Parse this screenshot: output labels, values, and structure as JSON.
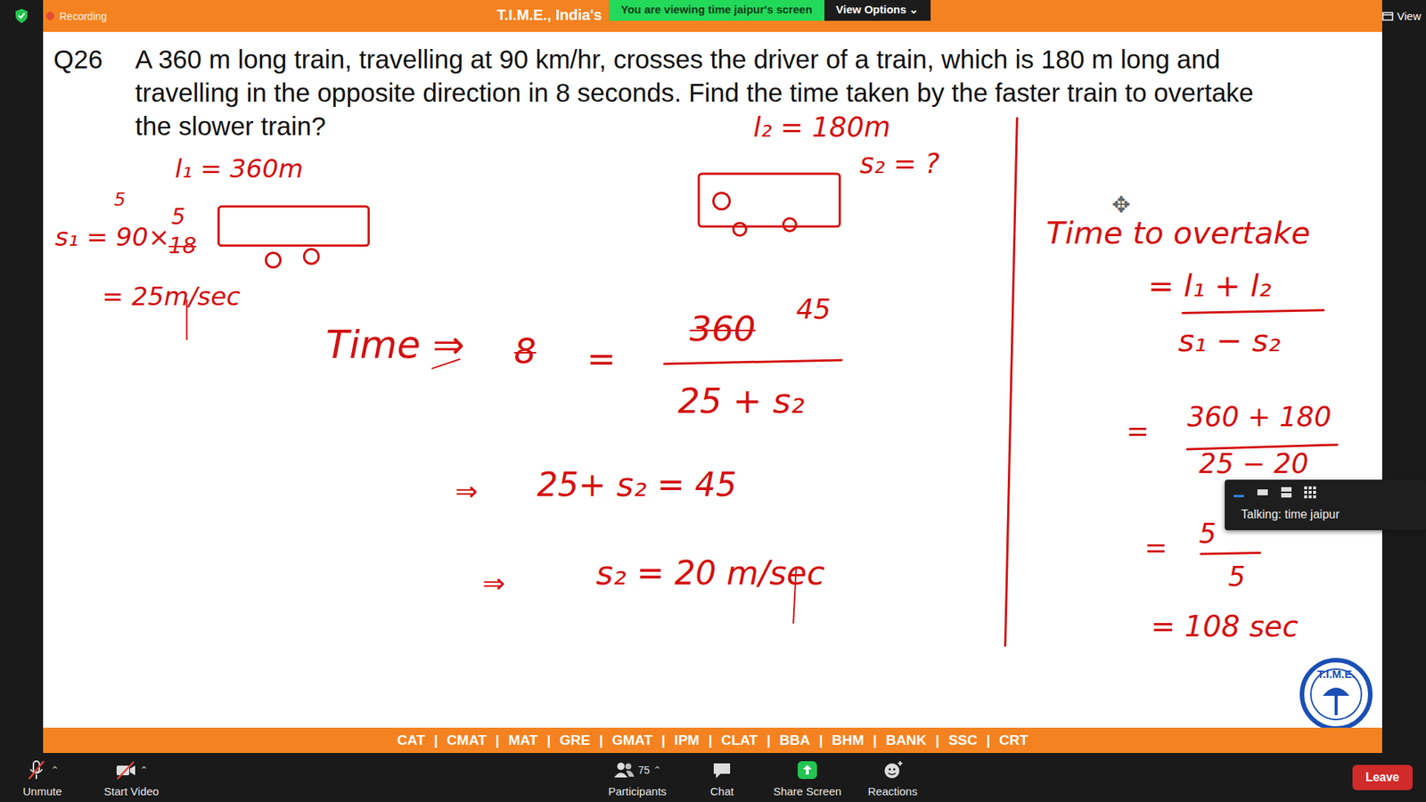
{
  "topbar": {
    "recording": "Recording",
    "title": "T.I.M.E., India's",
    "banner": "You are viewing time jaipur's screen",
    "view_options": "View Options ⌄",
    "view": "View"
  },
  "question": {
    "number": "Q26",
    "lines": [
      "A 360 m long train, travelling at 90 km/hr, crosses the driver of a train, which is 180 m long and",
      "travelling in the opposite direction in 8 seconds. Find the time taken by the faster train to overtake",
      "the slower train?"
    ]
  },
  "board": {
    "notes": [
      {
        "text": "l₁ = 360m",
        "struck": false
      },
      {
        "text": "5",
        "struck": false
      },
      {
        "text": "s₁ = 90×",
        "struck": false
      },
      {
        "text": "5",
        "struck": false
      },
      {
        "text": "18",
        "struck": true
      },
      {
        "text": "= 25m/sec",
        "struck": false
      },
      {
        "text": "l₂ = 180m",
        "struck": false
      },
      {
        "text": "s₂ = ?",
        "struck": false
      },
      {
        "text": "Time ⇒",
        "struck": false
      },
      {
        "text": "8",
        "struck": true
      },
      {
        "text": "=",
        "struck": false
      },
      {
        "text": "360",
        "struck": true
      },
      {
        "text": "45",
        "struck": false
      },
      {
        "text": "25 + s₂",
        "struck": false
      },
      {
        "text": "⇒",
        "struck": false
      },
      {
        "text": "25+ s₂ = 45",
        "struck": false
      },
      {
        "text": "⇒",
        "struck": false
      },
      {
        "text": "s₂ = 20 m/sec",
        "struck": false
      },
      {
        "text": "Time to overtake",
        "struck": false
      },
      {
        "text": "= l₁ + l₂",
        "struck": false
      },
      {
        "text": "s₁ − s₂",
        "struck": false
      },
      {
        "text": "=",
        "struck": false
      },
      {
        "text": "360 + 180",
        "struck": false
      },
      {
        "text": "25 − 20",
        "struck": false
      },
      {
        "text": "=",
        "struck": false
      },
      {
        "text": "5",
        "struck": false
      },
      {
        "text": "5",
        "struck": false
      },
      {
        "text": "= 108 sec",
        "struck": false
      }
    ],
    "move_cursor": "✥",
    "logo": "T.I.M.E."
  },
  "popup": {
    "talking": "Talking: time jaipur"
  },
  "exams": [
    "CAT",
    "CMAT",
    "MAT",
    "GRE",
    "GMAT",
    "IPM",
    "CLAT",
    "BBA",
    "BHM",
    "BANK",
    "SSC",
    "CRT"
  ],
  "exam_separator": "|",
  "toolbar": {
    "caret": "⌃",
    "left": [
      {
        "label": "Unmute",
        "kind": "mic",
        "caret": true,
        "count": ""
      },
      {
        "label": "Start Video",
        "kind": "video",
        "caret": true,
        "count": ""
      }
    ],
    "center": [
      {
        "label": "Participants",
        "kind": "participants",
        "caret": true,
        "count": "75"
      },
      {
        "label": "Chat",
        "kind": "chat",
        "caret": false,
        "count": ""
      },
      {
        "label": "Share Screen",
        "kind": "share",
        "caret": false,
        "count": ""
      },
      {
        "label": "Reactions",
        "kind": "reactions",
        "caret": false,
        "count": ""
      }
    ],
    "leave": "Leave"
  }
}
